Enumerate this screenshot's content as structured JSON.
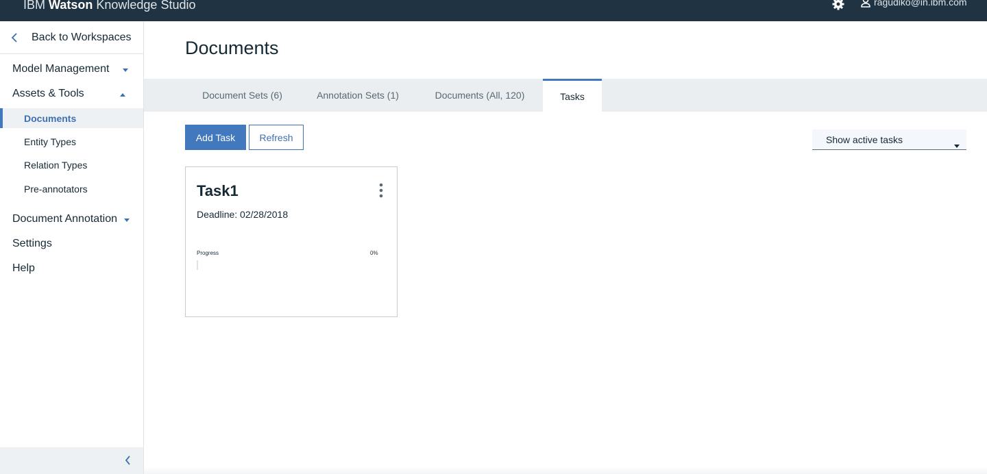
{
  "topbar": {
    "brand_prefix": "IBM",
    "brand_strong": "Watson",
    "brand_suffix": "Knowledge Studio",
    "user_email": "ragudiko@in.ibm.com",
    "icons": [
      "gear-icon",
      "user-icon"
    ]
  },
  "sidebar": {
    "back_label": "Back to Workspaces",
    "sections": [
      {
        "label": "Model Management",
        "expanded": false
      },
      {
        "label": "Assets & Tools",
        "expanded": true
      },
      {
        "label": "Document Annotation",
        "expanded": false
      },
      {
        "label": "Settings"
      },
      {
        "label": "Help"
      }
    ],
    "sub_items": [
      {
        "label": "Documents",
        "active": true
      },
      {
        "label": "Entity Types"
      },
      {
        "label": "Relation Types"
      },
      {
        "label": "Pre-annotators"
      }
    ]
  },
  "main": {
    "title": "Documents",
    "tabs": [
      {
        "label": "Document Sets (6)"
      },
      {
        "label": "Annotation Sets (1)"
      },
      {
        "label": "Documents (All, 120)"
      },
      {
        "label": "Tasks",
        "active": true
      }
    ],
    "add_task_label": "Add Task",
    "refresh_label": "Refresh",
    "filter_selected": "Show active tasks",
    "tasks": [
      {
        "name": "Task1",
        "deadline": "Deadline: 02/28/2018",
        "progress_label": "Progress",
        "progress_text": "0%",
        "progress_value": 0
      }
    ]
  },
  "colors": {
    "topbar": "#1f3342",
    "accent": "#4178be",
    "tabbar": "#eaeef0"
  }
}
